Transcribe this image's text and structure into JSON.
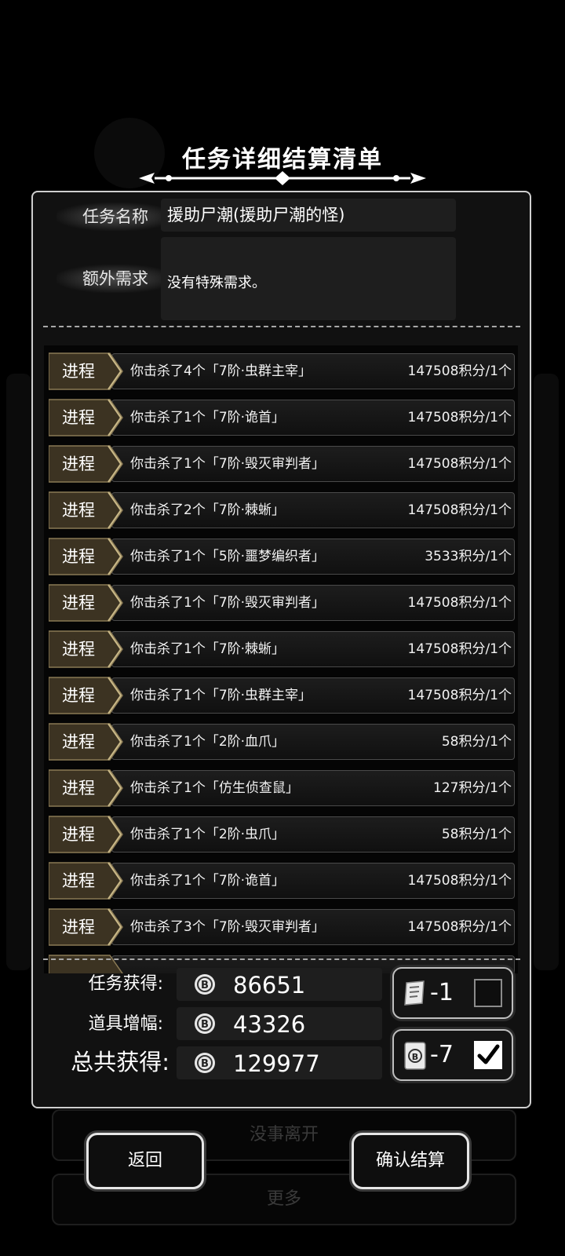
{
  "title": "任务详细结算清单",
  "task": {
    "name_label": "任务名称",
    "name_value": "援助尸潮(援助尸潮的怪)",
    "extra_label": "额外需求",
    "extra_value": "没有特殊需求。"
  },
  "progress_rows": [
    {
      "tag": "进程",
      "desc": "你击杀了4个「7阶·虫群主宰」",
      "points": "147508积分/1个"
    },
    {
      "tag": "进程",
      "desc": "你击杀了1个「7阶·诡首」",
      "points": "147508积分/1个"
    },
    {
      "tag": "进程",
      "desc": "你击杀了1个「7阶·毁灭审判者」",
      "points": "147508积分/1个"
    },
    {
      "tag": "进程",
      "desc": "你击杀了2个「7阶·棘蜥」",
      "points": "147508积分/1个"
    },
    {
      "tag": "进程",
      "desc": "你击杀了1个「5阶·噩梦编织者」",
      "points": "3533积分/1个"
    },
    {
      "tag": "进程",
      "desc": "你击杀了1个「7阶·毁灭审判者」",
      "points": "147508积分/1个"
    },
    {
      "tag": "进程",
      "desc": "你击杀了1个「7阶·棘蜥」",
      "points": "147508积分/1个"
    },
    {
      "tag": "进程",
      "desc": "你击杀了1个「7阶·虫群主宰」",
      "points": "147508积分/1个"
    },
    {
      "tag": "进程",
      "desc": "你击杀了1个「2阶·血爪」",
      "points": "58积分/1个"
    },
    {
      "tag": "进程",
      "desc": "你击杀了1个「仿生侦查鼠」",
      "points": "127积分/1个"
    },
    {
      "tag": "进程",
      "desc": "你击杀了1个「2阶·虫爪」",
      "points": "58积分/1个"
    },
    {
      "tag": "进程",
      "desc": "你击杀了1个「7阶·诡首」",
      "points": "147508积分/1个"
    },
    {
      "tag": "进程",
      "desc": "你击杀了3个「7阶·毁灭审判者」",
      "points": "147508积分/1个"
    }
  ],
  "summary": {
    "task_gain_label": "任务获得:",
    "task_gain_value": "86651",
    "item_boost_label": "道具增幅:",
    "item_boost_value": "43326",
    "total_label": "总共获得:",
    "total_value": "129977"
  },
  "items": [
    {
      "icon": "scroll-icon",
      "qty": "-1",
      "checked": false
    },
    {
      "icon": "coin-card-icon",
      "qty": "-7",
      "checked": true
    }
  ],
  "buttons": {
    "back": "返回",
    "confirm": "确认结算"
  },
  "background": {
    "leave_label": "没事离开",
    "more_label": "更多"
  }
}
